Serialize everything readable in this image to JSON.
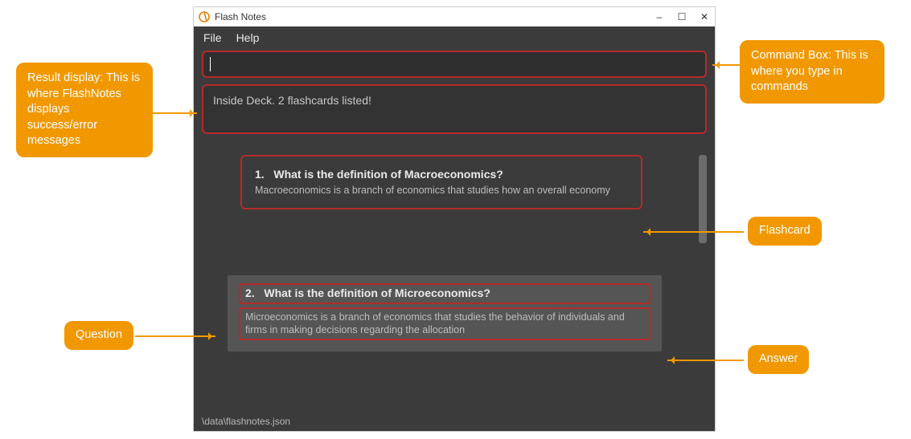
{
  "window": {
    "title": "Flash Notes",
    "minimize": "–",
    "maximize": "☐",
    "close": "✕"
  },
  "menubar": {
    "file": "File",
    "help": "Help"
  },
  "command_box": {
    "value": "",
    "placeholder": ""
  },
  "result_text": "Inside Deck. 2 flashcards listed!",
  "cards": [
    {
      "index": "1.",
      "question": "What is the definition of Macroeconomics?",
      "answer": "Macroeconomics is a branch of economics that studies how an overall economy"
    },
    {
      "index": "2.",
      "question": "What is the definition of Microeconomics?",
      "answer": "Microeconomics is a branch of economics that studies the behavior of individuals and firms in making decisions regarding the allocation"
    }
  ],
  "status_path": "\\data\\flashnotes.json",
  "callouts": {
    "result": "Result display: This is where FlashNotes displays success/error messages",
    "command": "Command Box: This is where you type in commands",
    "flashcard": "Flashcard",
    "question": "Question",
    "answer": "Answer"
  }
}
